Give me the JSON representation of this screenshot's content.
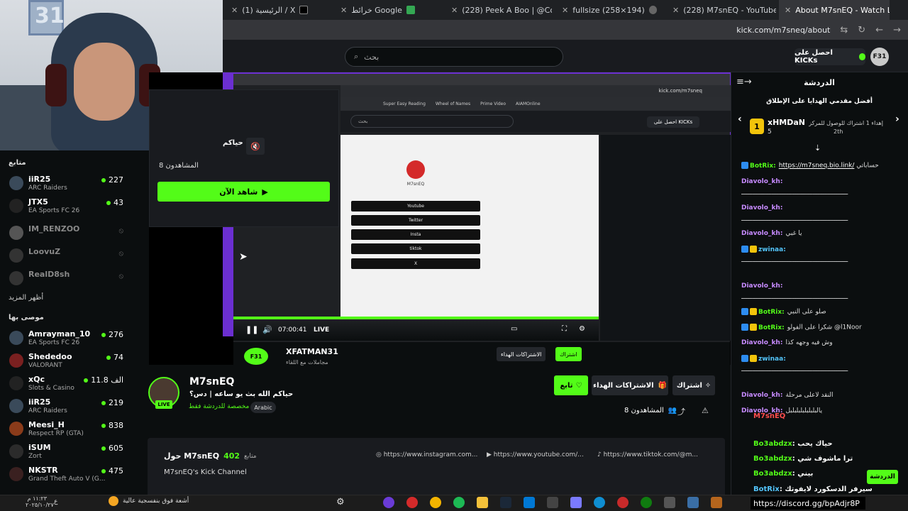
{
  "browser": {
    "tabs": [
      {
        "label": "(1) الرئيسية / X",
        "active": false
      },
      {
        "label": "خرائط Google",
        "active": false
      },
      {
        "label": "(228) Peek A Boo | @CoComelo",
        "active": false
      },
      {
        "label": "fullsize (258×194)",
        "active": false
      },
      {
        "label": "(228) M7snEQ - YouTube",
        "active": false
      },
      {
        "label": "About M7snEQ - Watch Live on",
        "active": true
      }
    ],
    "url": "kick.com/m7sneq/about"
  },
  "header": {
    "search_placeholder": "بحث",
    "get_kicks": "احصل على KICKs",
    "avatar_text": "F31"
  },
  "webcam": {
    "wall_text": "31"
  },
  "sidebar": {
    "following_title": "متابع",
    "following": [
      {
        "name": "iiR25",
        "category": "ARC Raiders",
        "viewers": "227",
        "live": true
      },
      {
        "name": "JTX5",
        "category": "EA Sports FC 26",
        "viewers": "43",
        "live": true
      },
      {
        "name": "IM_RENZOO",
        "category": "",
        "viewers": "",
        "live": false
      },
      {
        "name": "LoovuZ",
        "category": "",
        "viewers": "",
        "live": false
      },
      {
        "name": "RealD8sh",
        "category": "",
        "viewers": "",
        "live": false
      }
    ],
    "show_more": "أظهر المزيد",
    "recommended_title": "موصى بها",
    "recommended": [
      {
        "name": "Amrayman_10",
        "category": "EA Sports FC 26",
        "viewers": "276"
      },
      {
        "name": "Shededoo",
        "category": "VALORANT",
        "viewers": "74"
      },
      {
        "name": "xQc",
        "category": "Slots & Casino",
        "viewers": "الف 11.8"
      },
      {
        "name": "iiR25",
        "category": "ARC Raiders",
        "viewers": "219"
      },
      {
        "name": "Meesi_H",
        "category": "Respect RP (GTA)",
        "viewers": "838"
      },
      {
        "name": "iSUM",
        "category": "Zort",
        "viewers": "605"
      },
      {
        "name": "NKSTR",
        "category": "Grand Theft Auto V (G...",
        "viewers": "475"
      }
    ]
  },
  "popout": {
    "title": "حياكم",
    "viewers": "المشاهدون 8",
    "watch_now": "شاهد الآن"
  },
  "video": {
    "time": "07:00:41",
    "live": "LIVE",
    "nested_url": "kick.com/m7sneq",
    "nested_search": "بحث",
    "nested_kicks": "احصل على KICKs",
    "nested_bookmarks": [
      "Super Easy Reading",
      "Wheel of Names",
      "Prime Video",
      "AIAMOnline"
    ],
    "nested_links": [
      "Youtube",
      "Twitter",
      "Insta",
      "tiktok",
      "X"
    ],
    "nested_name": "M7snEQ",
    "under_name": "XFATMAN31",
    "under_sub": "مجاملات مع اللقاء",
    "under_subscribe": "اشتراك",
    "under_gift": "الاشتراكات الهداء"
  },
  "channel": {
    "name": "M7snEQ",
    "title": "حياكم الله بث يو ساعه | دس؟",
    "category": "مخصصة للدردشة فقط",
    "language": "Arabic",
    "live": "LIVE",
    "follow": "تابع",
    "gift_subs": "الاشتراكات الهداء",
    "subscribe": "اشتراك",
    "viewers": "المشاهدون 8"
  },
  "about": {
    "title": "حول M7snEQ",
    "followers": "402",
    "followers_label": "متابع",
    "description": "M7snEQ's Kick Channel",
    "socials": [
      "https://www.instagram.com...",
      "https://www.youtube.com/...",
      "https://www.tiktok.com/@m..."
    ]
  },
  "chat": {
    "title": "الدردشة",
    "gift_title": "أفضل مقدمي الهدايا على الإطلاق",
    "top_gifter": {
      "name": "xHMDaN",
      "count": "5",
      "rank_num": "1",
      "note": "إهداء 1 اشتراك للوصول للمركز",
      "rank": "2th"
    },
    "messages": [
      {
        "user": "BotRix:",
        "cls": "bot",
        "text": "حساباتي",
        "link": "https://m7sneq.bio.link/"
      },
      {
        "user": "Diavolo_kh:",
        "cls": "dia",
        "text": ""
      },
      {
        "user": "",
        "cls": "tx",
        "text": "ـــــــــــــــــــــــــــــــــــــــــــــــــــــــــ"
      },
      {
        "user": "Diavolo_kh:",
        "cls": "dia",
        "text": ""
      },
      {
        "user": "",
        "cls": "tx",
        "text": "ـــــــــــــــــــــــــــــــــــــــــــــــــــــــــ"
      },
      {
        "user": "Diavolo_kh:",
        "cls": "dia",
        "text": "يا غبي"
      },
      {
        "user": "zwinaa:",
        "cls": "zw",
        "text": ""
      },
      {
        "user": "",
        "cls": "tx",
        "text": "ـــــــــــــــــــــــــــــــــــــــــــــــــــــــــ"
      },
      {
        "user": "Diavolo_kh:",
        "cls": "dia",
        "text": ""
      },
      {
        "user": "",
        "cls": "tx",
        "text": "ـــــــــــــــــــــــــــــــــــــــــــــــــــــــــ"
      },
      {
        "user": "BotRix:",
        "cls": "bot",
        "text": "صلو على النبي"
      },
      {
        "user": "BotRix:",
        "cls": "bot",
        "text": "شكراً على الفولو @l1Noor"
      },
      {
        "user": "Diavolo_kh:",
        "cls": "dia",
        "text": "وش فيه وجهه كذا"
      },
      {
        "user": "zwinaa:",
        "cls": "zw",
        "text": ""
      },
      {
        "user": "",
        "cls": "tx",
        "text": "ـــــــــــــــــــــــــــــــــــــــــــــــــــــــــ"
      },
      {
        "user": "Diavolo_kh:",
        "cls": "dia",
        "text": "النقد لأعلى مرحلة"
      },
      {
        "user": "Diavolo_kh:",
        "cls": "dia",
        "text": "يالبلبلبلبلبلبلبل"
      }
    ],
    "overlay": [
      {
        "user": "M7snEQ",
        "text": ""
      },
      {
        "user": "Bo3abdzx",
        "text": ": حياك يحب"
      },
      {
        "user": "Bo3abdzx",
        "text": ": ترا ماشوف شي"
      },
      {
        "user": "Bo3abdzx",
        "text": ": بيني"
      },
      {
        "user": "BotRix",
        "text": ": سيرفر الدسكورد لايفوتك"
      }
    ],
    "send": "الدردشة",
    "tooltip": "https://discord.gg/bpAdjr8P"
  },
  "taskbar": {
    "weather": "أشعة فوق بنفسجية عالية",
    "time": "١١:٢٣ م",
    "date": "٢٠٢٥/١٠/٢٧",
    "lang": "ع"
  }
}
